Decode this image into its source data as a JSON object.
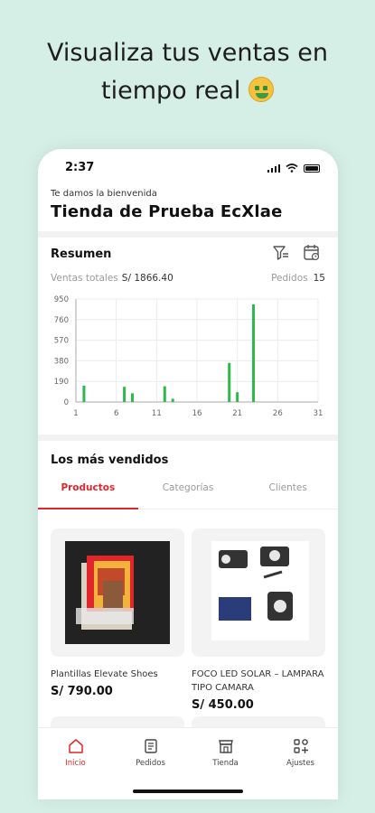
{
  "headline": {
    "line1": "Visualiza tus ventas en",
    "line2": "tiempo real"
  },
  "status": {
    "time": "2:37"
  },
  "header": {
    "welcome": "Te damos la bienvenida",
    "store_name": "Tienda de Prueba EcXlae"
  },
  "summary": {
    "title": "Resumen",
    "total_label": "Ventas totales",
    "total_value": "S/ 1866.40",
    "orders_label": "Pedidos",
    "orders_value": "15",
    "icons": [
      "filter-icon",
      "calendar-icon"
    ]
  },
  "chart_data": {
    "type": "bar",
    "x": [
      2,
      7,
      8,
      12,
      13,
      20,
      21,
      23
    ],
    "values": [
      150,
      140,
      80,
      145,
      30,
      360,
      90,
      900
    ],
    "xticks": [
      1,
      6,
      11,
      16,
      21,
      26,
      31
    ],
    "yticks": [
      0,
      190,
      380,
      570,
      760,
      950
    ],
    "xlim": [
      1,
      31
    ],
    "ylim": [
      0,
      950
    ],
    "grid": true,
    "color": "#2db84a"
  },
  "best_sellers": {
    "title": "Los más vendidos",
    "tabs": [
      "Productos",
      "Categorías",
      "Clientes"
    ],
    "active_tab": 0,
    "products": [
      {
        "name": "Plantillas Elevate Shoes",
        "price": "S/ 790.00"
      },
      {
        "name": "FOCO LED SOLAR – LAMPARA TIPO CAMARA",
        "price": "S/ 450.00"
      }
    ]
  },
  "nav": {
    "items": [
      {
        "label": "Inicio",
        "icon": "home-icon",
        "active": true
      },
      {
        "label": "Pedidos",
        "icon": "orders-icon",
        "active": false
      },
      {
        "label": "Tienda",
        "icon": "store-icon",
        "active": false
      },
      {
        "label": "Ajustes",
        "icon": "settings-icon",
        "active": false
      }
    ]
  },
  "colors": {
    "accent": "#e0262a",
    "bar": "#2db84a",
    "background": "#d5efe6"
  }
}
